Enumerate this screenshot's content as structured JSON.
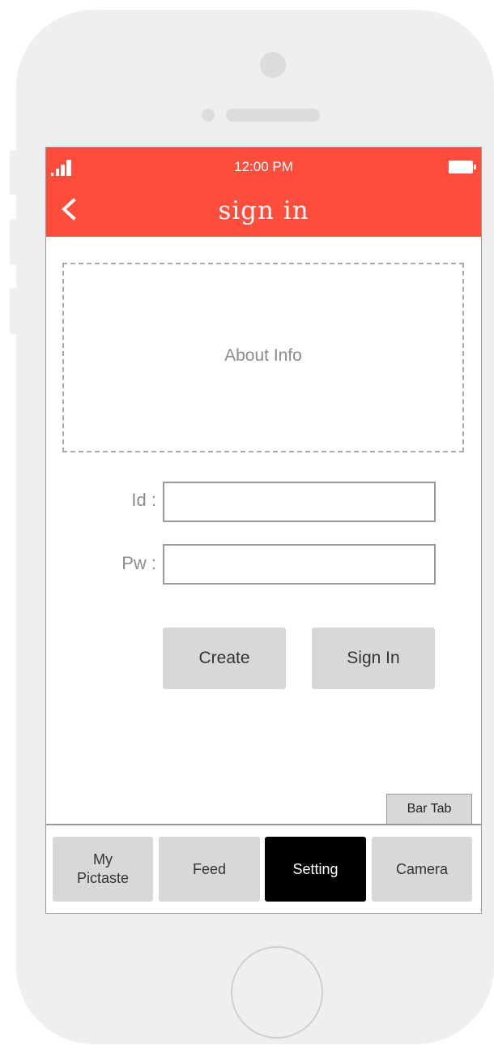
{
  "status_bar": {
    "time": "12:00 PM",
    "signal_icon": "signal-bars-icon",
    "battery_icon": "battery-icon"
  },
  "nav": {
    "title": "sign in",
    "back_icon": "chevron-left-icon"
  },
  "about": {
    "text": "About Info"
  },
  "form": {
    "id_label": "Id :",
    "id_value": "",
    "pw_label": "Pw :",
    "pw_value": ""
  },
  "buttons": {
    "create": "Create",
    "sign_in": "Sign In"
  },
  "bar_tab": {
    "label": "Bar Tab"
  },
  "tabs": [
    {
      "label": "My\nPictaste",
      "active": false
    },
    {
      "label": "Feed",
      "active": false
    },
    {
      "label": "Setting",
      "active": true
    },
    {
      "label": "Camera",
      "active": false
    }
  ],
  "colors": {
    "header": "#fe4e3b",
    "active_tab": "#000000",
    "button": "#d8d8d8"
  }
}
